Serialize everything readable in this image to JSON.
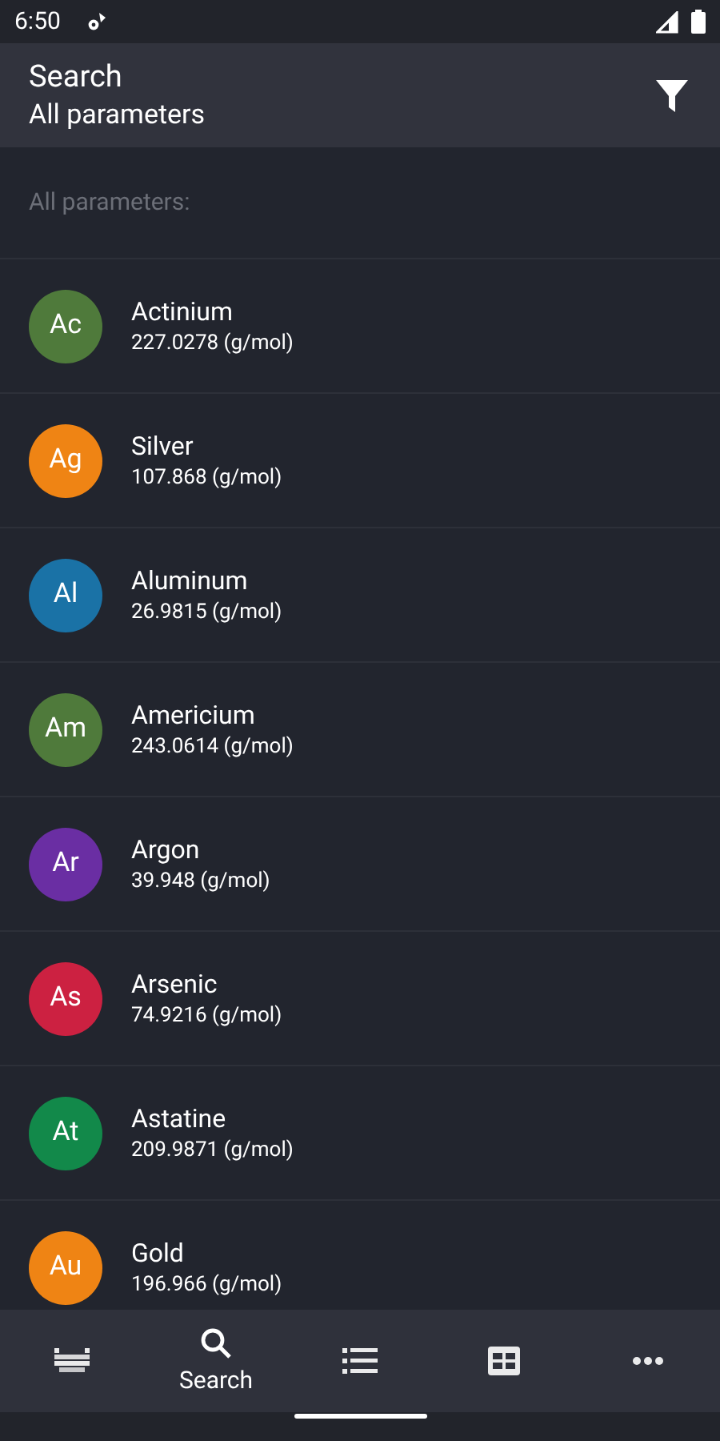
{
  "status_bar": {
    "time": "6:50"
  },
  "header": {
    "title": "Search",
    "subtitle": "All parameters"
  },
  "section_label": "All parameters:",
  "elements": [
    {
      "symbol": "Ac",
      "name": "Actinium",
      "mass": "227.0278 (g/mol)",
      "color": "#4f7a3b"
    },
    {
      "symbol": "Ag",
      "name": "Silver",
      "mass": "107.868 (g/mol)",
      "color": "#ef8414"
    },
    {
      "symbol": "Al",
      "name": "Aluminum",
      "mass": "26.9815 (g/mol)",
      "color": "#1a72a6"
    },
    {
      "symbol": "Am",
      "name": "Americium",
      "mass": "243.0614 (g/mol)",
      "color": "#4f7a3b"
    },
    {
      "symbol": "Ar",
      "name": "Argon",
      "mass": "39.948 (g/mol)",
      "color": "#6a2ea3"
    },
    {
      "symbol": "As",
      "name": "Arsenic",
      "mass": "74.9216 (g/mol)",
      "color": "#cc2141"
    },
    {
      "symbol": "At",
      "name": "Astatine",
      "mass": "209.9871 (g/mol)",
      "color": "#12894a"
    },
    {
      "symbol": "Au",
      "name": "Gold",
      "mass": "196.966 (g/mol)",
      "color": "#ef8414"
    }
  ],
  "bottom_nav": [
    {
      "kind": "table",
      "selected": false
    },
    {
      "kind": "search",
      "label": "Search",
      "selected": true
    },
    {
      "kind": "list",
      "selected": false
    },
    {
      "kind": "grid",
      "selected": false
    },
    {
      "kind": "more",
      "selected": false
    }
  ]
}
